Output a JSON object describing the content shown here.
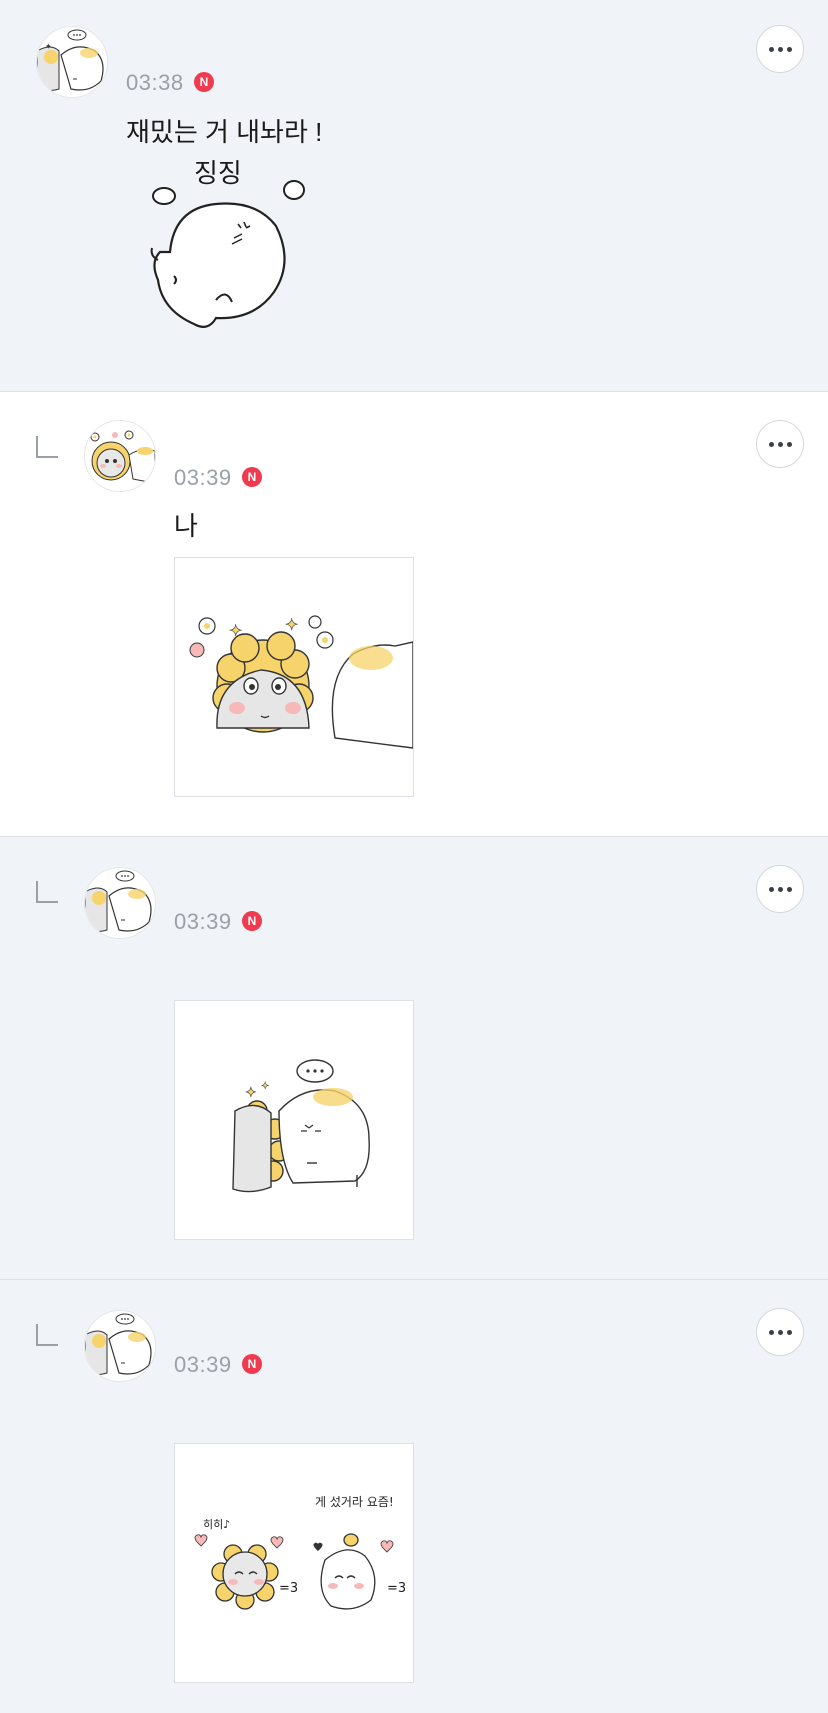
{
  "comments": [
    {
      "time": "03:38",
      "badge": "N",
      "text": "재밌는 거 내놔라 !",
      "sticker_caption": "징징",
      "avatar_icon": "sticker-avatar-pair",
      "sticker_icon": "round-white-creature-sticker"
    },
    {
      "time": "03:39",
      "badge": "N",
      "text": "나",
      "avatar_icon": "sunflower-creature-avatar",
      "sticker_icon": "sunflower-creature-sticker"
    },
    {
      "time": "03:39",
      "badge": "N",
      "avatar_icon": "sticker-avatar-pair",
      "sticker_icon": "two-creatures-sticker"
    },
    {
      "time": "03:39",
      "badge": "N",
      "avatar_icon": "sticker-avatar-pair",
      "sticker_icon": "creatures-with-hearts-sticker",
      "sticker_text_left": "히히♪",
      "sticker_text_right": "게 섰거라 요즘!",
      "sticker_text_puff": "=3"
    }
  ],
  "colors": {
    "highlight_bg": "#f0f4f9",
    "badge": "#ef3a4f",
    "time": "#9aa0a7",
    "sunflower_yellow": "#f7d36b",
    "blush": "#f7b8b8"
  }
}
